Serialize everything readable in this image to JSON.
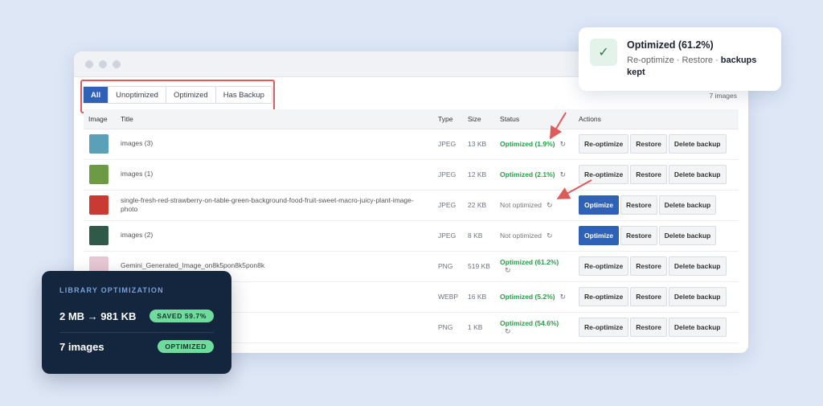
{
  "filters": [
    {
      "label": "All",
      "active": true
    },
    {
      "label": "Unoptimized",
      "active": false
    },
    {
      "label": "Optimized",
      "active": false
    },
    {
      "label": "Has Backup",
      "active": false
    }
  ],
  "image_count": "7 images",
  "columns": [
    "Image",
    "Title",
    "Type",
    "Size",
    "Status",
    "Actions"
  ],
  "rows": [
    {
      "title": "images (3)",
      "type": "JPEG",
      "size": "13 KB",
      "status": "Optimized (1.9%)",
      "optimized": true,
      "actions": [
        "Re-optimize",
        "Restore",
        "Delete backup"
      ],
      "thumb": "#5aa0b8"
    },
    {
      "title": "images (1)",
      "type": "JPEG",
      "size": "12 KB",
      "status": "Optimized (2.1%)",
      "optimized": true,
      "actions": [
        "Re-optimize",
        "Restore",
        "Delete backup"
      ],
      "thumb": "#6c9a45"
    },
    {
      "title": "single-fresh-red-strawberry-on-table-green-background-food-fruit-sweet-macro-juicy-plant-image-photo",
      "type": "JPEG",
      "size": "22 KB",
      "status": "Not optimized",
      "optimized": false,
      "actions": [
        "Optimize",
        "Restore",
        "Delete backup"
      ],
      "thumb": "#c93a33"
    },
    {
      "title": "images (2)",
      "type": "JPEG",
      "size": "8 KB",
      "status": "Not optimized",
      "optimized": false,
      "actions": [
        "Optimize",
        "Restore",
        "Delete backup"
      ],
      "thumb": "#2f5a4a"
    },
    {
      "title": "Gemini_Generated_Image_on8k5pon8k5pon8k",
      "type": "PNG",
      "size": "519 KB",
      "status": "Optimized (61.2%)",
      "optimized": true,
      "actions": [
        "Re-optimize",
        "Restore",
        "Delete backup"
      ],
      "thumb": "#e8c7d4"
    },
    {
      "title": "",
      "type": "WEBP",
      "size": "16 KB",
      "status": "Optimized (5.2%)",
      "optimized": true,
      "actions": [
        "Re-optimize",
        "Restore",
        "Delete backup"
      ],
      "thumb": ""
    },
    {
      "title": "",
      "type": "PNG",
      "size": "1 KB",
      "status": "Optimized (54.6%)",
      "optimized": true,
      "actions": [
        "Re-optimize",
        "Restore",
        "Delete backup"
      ],
      "thumb": ""
    }
  ],
  "toast": {
    "title": "Optimized (61.2%)",
    "sub_plain": "Re-optimize · Restore ·",
    "sub_bold": "backups kept"
  },
  "stats": {
    "heading": "LIBRARY OPTIMIZATION",
    "size_line": "2 MB → 981 KB",
    "saved_badge": "SAVED 59.7%",
    "count_line": "7 images",
    "status_badge": "OPTIMIZED"
  },
  "colors": {
    "accent": "#2f62b7",
    "success": "#22a046",
    "annotation": "#e05a5a",
    "panel_bg": "#13263e",
    "badge_green": "#6fdc9e"
  }
}
